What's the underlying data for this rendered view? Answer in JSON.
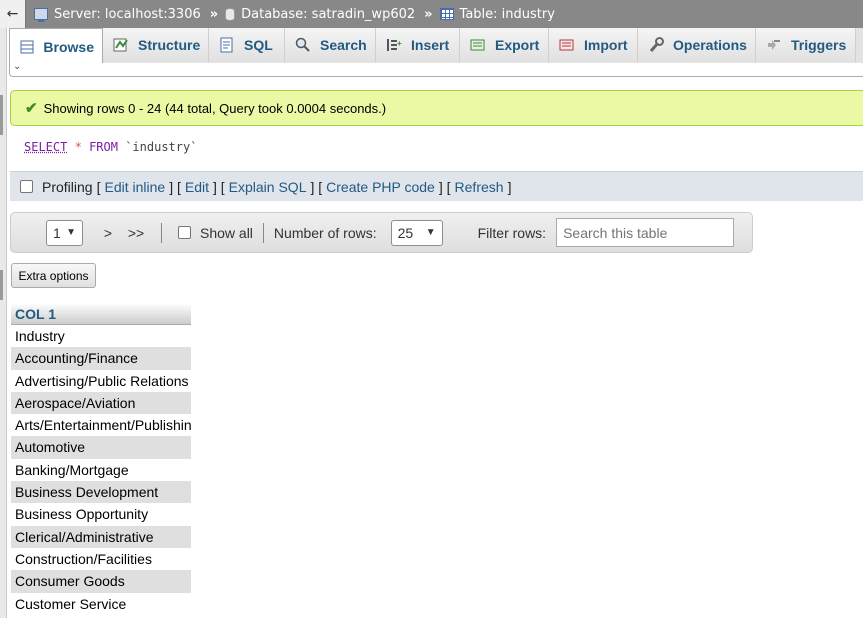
{
  "breadcrumb": {
    "collapse_icon": "←",
    "server_label": "Server: localhost:3306",
    "database_label": "Database: satradin_wp602",
    "table_label": "Table: industry",
    "separator": "»"
  },
  "tabs": [
    {
      "label": "Browse",
      "icon": "browse-icon"
    },
    {
      "label": "Structure",
      "icon": "structure-icon"
    },
    {
      "label": "SQL",
      "icon": "sql-icon"
    },
    {
      "label": "Search",
      "icon": "search-icon"
    },
    {
      "label": "Insert",
      "icon": "insert-icon"
    },
    {
      "label": "Export",
      "icon": "export-icon"
    },
    {
      "label": "Import",
      "icon": "import-icon"
    },
    {
      "label": "Operations",
      "icon": "wrench-icon"
    },
    {
      "label": "Triggers",
      "icon": "triggers-icon"
    }
  ],
  "message": {
    "text": "Showing rows 0 - 24 (44 total, Query took 0.0004 seconds.)",
    "icon": "✔"
  },
  "query": {
    "select": "SELECT",
    "star": "*",
    "from": "FROM",
    "table": "`industry`"
  },
  "profiling": {
    "label": "Profiling",
    "links": [
      "Edit inline",
      "Edit",
      "Explain SQL",
      "Create PHP code",
      "Refresh"
    ]
  },
  "navigation": {
    "page": "1",
    "next": ">",
    "last": ">>",
    "show_all": "Show all",
    "rows_label": "Number of rows:",
    "rows_value": "25",
    "filter_label": "Filter rows:",
    "filter_placeholder": "Search this table"
  },
  "extra_options": "Extra options",
  "table": {
    "header": "COL 1",
    "rows": [
      "Industry",
      "Accounting/Finance",
      "Advertising/Public Relations",
      "Aerospace/Aviation",
      "Arts/Entertainment/Publishing",
      "Automotive",
      "Banking/Mortgage",
      "Business Development",
      "Business Opportunity",
      "Clerical/Administrative",
      "Construction/Facilities",
      "Consumer Goods",
      "Customer Service"
    ]
  },
  "colors": {
    "topbar": "#888888",
    "link": "#235a81",
    "success_bg": "#ebf8a4",
    "success_border": "#a2d246",
    "row_alt": "#dfdfdf"
  }
}
